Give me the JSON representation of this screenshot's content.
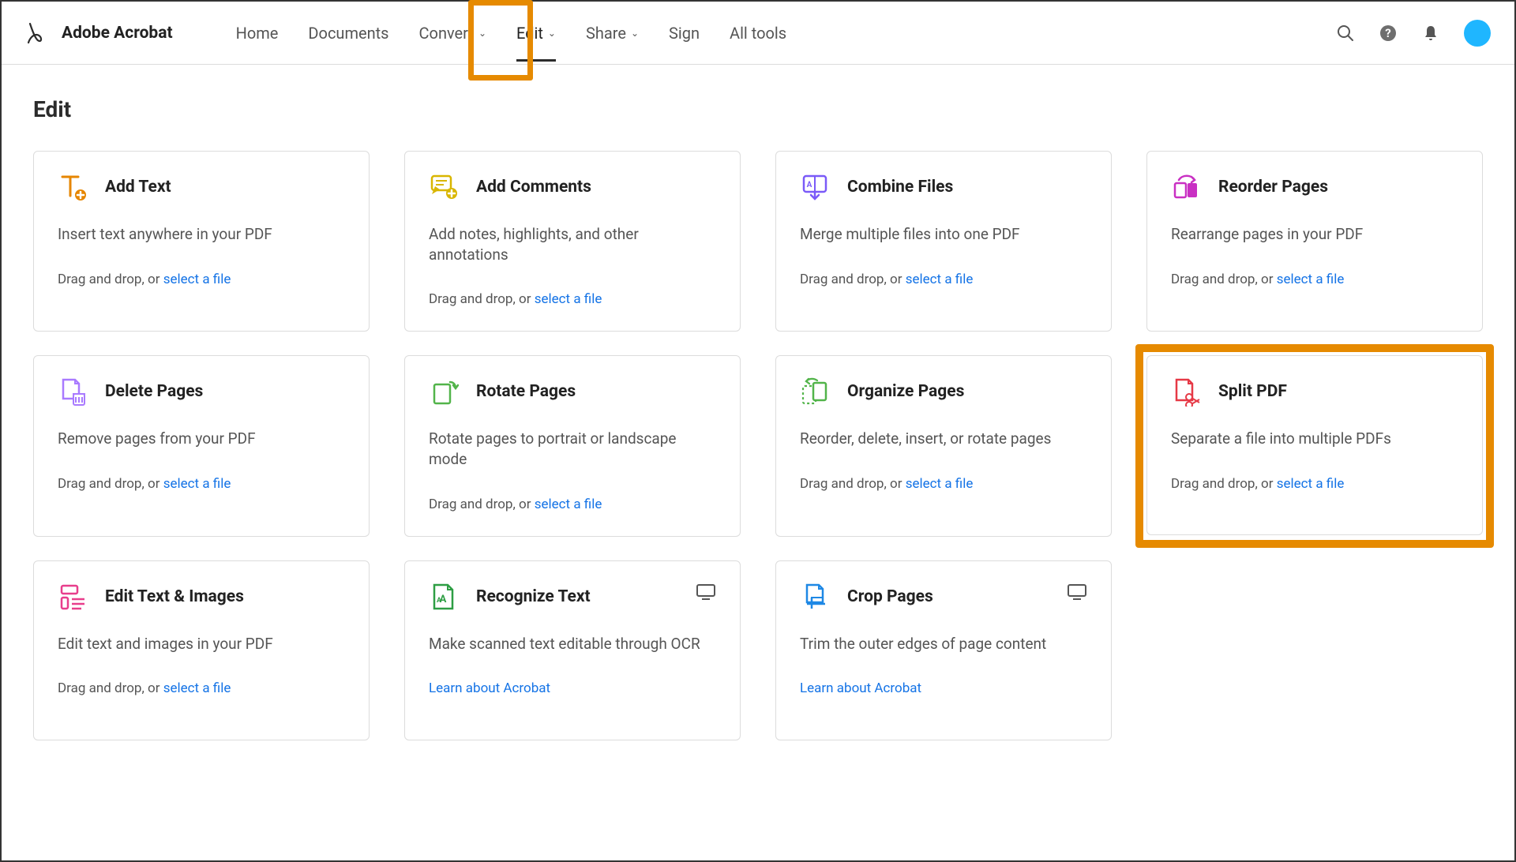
{
  "brand": "Adobe Acrobat",
  "nav": {
    "home": "Home",
    "documents": "Documents",
    "convert": "Convert",
    "edit": "Edit",
    "share": "Share",
    "sign": "Sign",
    "all_tools": "All tools"
  },
  "page_title": "Edit",
  "footer_prefix": "Drag and drop, or ",
  "footer_link": "select a file",
  "learn_link": "Learn about Acrobat",
  "cards": {
    "add_text": {
      "title": "Add Text",
      "desc": "Insert text anywhere in your PDF"
    },
    "add_comments": {
      "title": "Add Comments",
      "desc": "Add notes, highlights, and other annotations"
    },
    "combine_files": {
      "title": "Combine Files",
      "desc": "Merge multiple files into one PDF"
    },
    "reorder_pages": {
      "title": "Reorder Pages",
      "desc": "Rearrange pages in your PDF"
    },
    "delete_pages": {
      "title": "Delete Pages",
      "desc": "Remove pages from your PDF"
    },
    "rotate_pages": {
      "title": "Rotate Pages",
      "desc": "Rotate pages to portrait or landscape mode"
    },
    "organize_pages": {
      "title": "Organize Pages",
      "desc": "Reorder, delete, insert, or rotate pages"
    },
    "split_pdf": {
      "title": "Split PDF",
      "desc": "Separate a file into multiple PDFs"
    },
    "edit_text_images": {
      "title": "Edit Text & Images",
      "desc": "Edit text and images in your PDF"
    },
    "recognize_text": {
      "title": "Recognize Text",
      "desc": "Make scanned text editable through OCR"
    },
    "crop_pages": {
      "title": "Crop Pages",
      "desc": "Trim the outer edges of page content"
    }
  }
}
